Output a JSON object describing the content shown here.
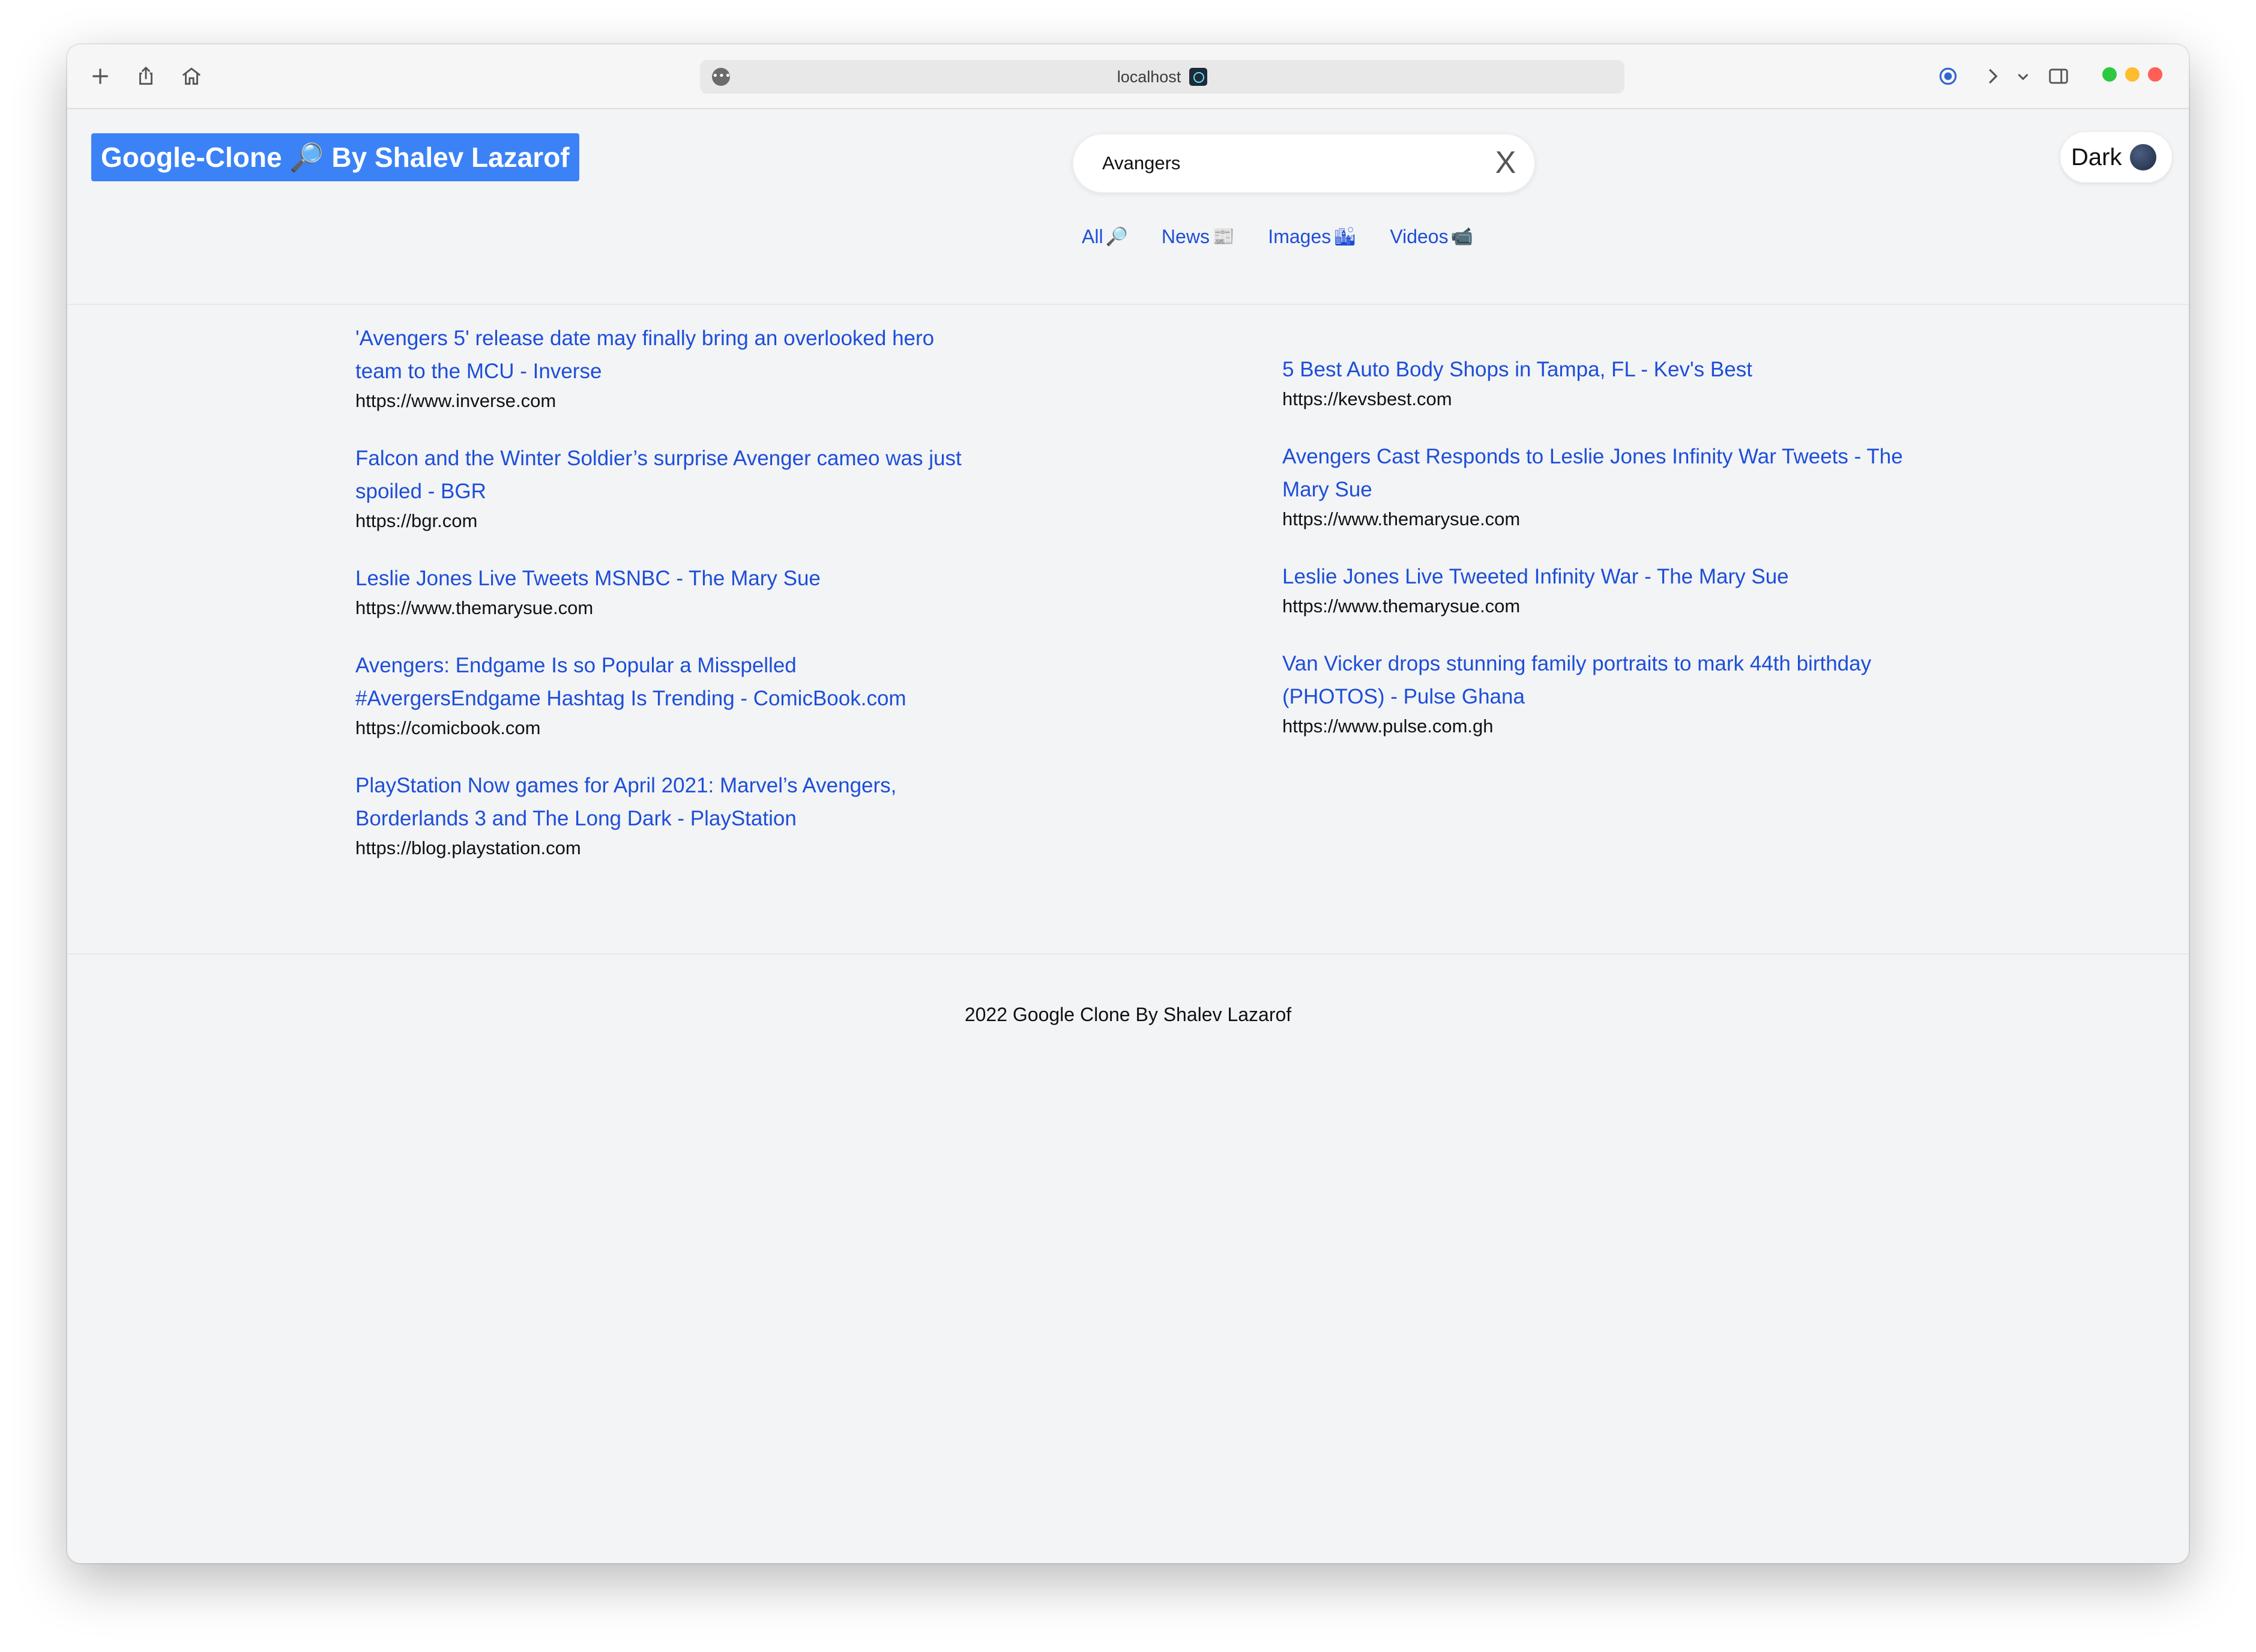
{
  "browser": {
    "url": "localhost",
    "site_info_icon": "dots-icon"
  },
  "header": {
    "logo_text": "Google-Clone 🔎 By Shalev Lazarof",
    "search": {
      "value": "Avangers",
      "clear_label": "X"
    },
    "theme_toggle_label": "Dark"
  },
  "tabs": [
    {
      "label": "All",
      "icon": "🔎"
    },
    {
      "label": "News",
      "icon": "📰"
    },
    {
      "label": "Images",
      "icon": "🏙"
    },
    {
      "label": "Videos",
      "icon": "📹"
    }
  ],
  "results": {
    "left": [
      {
        "title": "'Avengers 5' release date may finally bring an overlooked hero team to the MCU - Inverse",
        "url": "https://www.inverse.com"
      },
      {
        "title": "Falcon and the Winter Soldier’s surprise Avenger cameo was just spoiled - BGR",
        "url": "https://bgr.com"
      },
      {
        "title": "Leslie Jones Live Tweets MSNBC - The Mary Sue",
        "url": "https://www.themarysue.com"
      },
      {
        "title": "Avengers: Endgame Is so Popular a Misspelled #AvergersEndgame Hashtag Is Trending - ComicBook.com",
        "url": "https://comicbook.com"
      },
      {
        "title": "PlayStation Now games for April 2021: Marvel’s Avengers, Borderlands 3 and The Long Dark - PlayStation",
        "url": "https://blog.playstation.com"
      }
    ],
    "right": [
      {
        "title": "5 Best Auto Body Shops in Tampa, FL - Kev's Best",
        "url": "https://kevsbest.com"
      },
      {
        "title": "Avengers Cast Responds to Leslie Jones Infinity War Tweets - The Mary Sue",
        "url": "https://www.themarysue.com"
      },
      {
        "title": "Leslie Jones Live Tweeted Infinity War - The Mary Sue",
        "url": "https://www.themarysue.com"
      },
      {
        "title": "Van Vicker drops stunning family portraits to mark 44th birthday (PHOTOS) - Pulse Ghana",
        "url": "https://www.pulse.com.gh"
      }
    ]
  },
  "footer": {
    "text": "2022 Google Clone By Shalev Lazarof"
  },
  "colors": {
    "accent": "#3b82f6",
    "link": "#1d4ed8",
    "page_bg": "#f3f4f6",
    "traffic_green": "#2ec840",
    "traffic_yellow": "#febc2e",
    "traffic_red": "#ff5f57"
  }
}
